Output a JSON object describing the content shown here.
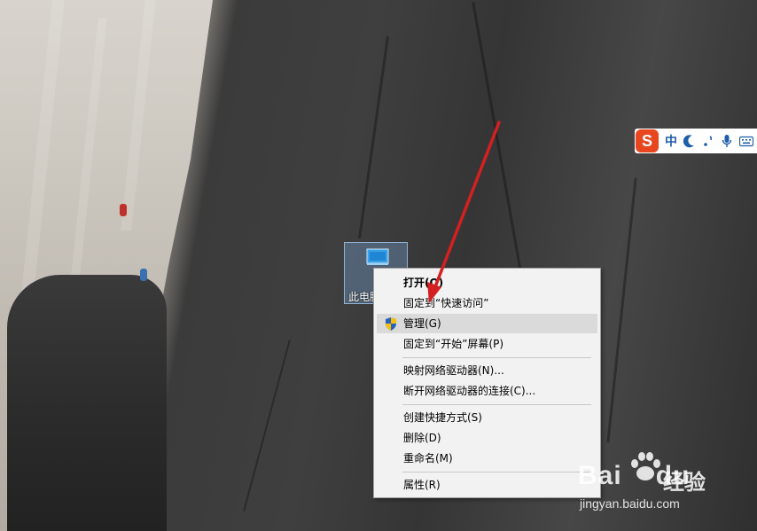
{
  "desktop": {
    "icon_label": "此电脑"
  },
  "context_menu": {
    "items": [
      {
        "label": "打开(O)"
      },
      {
        "label": "固定到“快速访问”"
      },
      {
        "label": "管理(G)"
      },
      {
        "label": "固定到“开始”屏幕(P)"
      },
      {
        "label": "映射网络驱动器(N)..."
      },
      {
        "label": "断开网络驱动器的连接(C)..."
      },
      {
        "label": "创建快捷方式(S)"
      },
      {
        "label": "删除(D)"
      },
      {
        "label": "重命名(M)"
      },
      {
        "label": "属性(R)"
      }
    ]
  },
  "ime_toolbar": {
    "logo": "S",
    "mode": "中",
    "icons": [
      "moon-icon",
      "punctuation-icon",
      "microphone-icon",
      "keyboard-icon"
    ]
  },
  "watermark": {
    "brand": "Bai",
    "brand_suffix": "du",
    "product": "经验",
    "url": "jingyan.baidu.com"
  },
  "colors": {
    "arrow": "#d42020",
    "menu_highlight": "#dadada",
    "ime_logo": "#e8461f",
    "ime_text": "#1f5fa8"
  }
}
